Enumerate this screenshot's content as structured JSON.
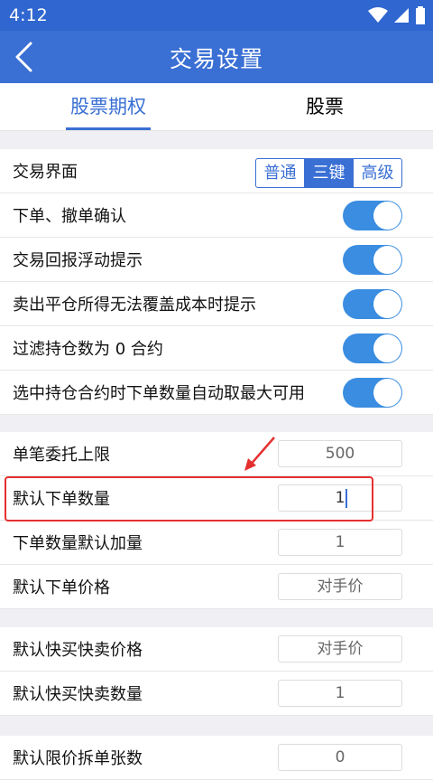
{
  "status_bar": {
    "time": "4:12"
  },
  "header": {
    "title": "交易设置"
  },
  "tabs": [
    {
      "label": "股票期权",
      "active": true
    },
    {
      "label": "股票",
      "active": false
    }
  ],
  "trade_ui": {
    "label": "交易界面",
    "options": [
      "普通",
      "三键",
      "高级"
    ],
    "selected": "三键"
  },
  "toggles": [
    {
      "label": "下单、撤单确认",
      "on": true
    },
    {
      "label": "交易回报浮动提示",
      "on": true
    },
    {
      "label": "卖出平仓所得无法覆盖成本时提示",
      "on": true
    },
    {
      "label": "过滤持仓数为 0 合约",
      "on": true
    },
    {
      "label": "选中持仓合约时下单数量自动取最大可用",
      "on": true
    }
  ],
  "order_settings": [
    {
      "label": "单笔委托上限",
      "value": "500"
    },
    {
      "label": "默认下单数量",
      "value": "1"
    },
    {
      "label": "下单数量默认加量",
      "value": "1"
    },
    {
      "label": "默认下单价格",
      "value": "对手价"
    }
  ],
  "quick_settings": [
    {
      "label": "默认快买快卖价格",
      "value": "对手价"
    },
    {
      "label": "默认快买快卖数量",
      "value": "1"
    }
  ],
  "split_settings": [
    {
      "label": "默认限价拆单张数",
      "value": "0"
    }
  ],
  "colors": {
    "primary": "#3a6fd4",
    "toggle_on": "#3a8de0",
    "highlight": "#e53030"
  }
}
